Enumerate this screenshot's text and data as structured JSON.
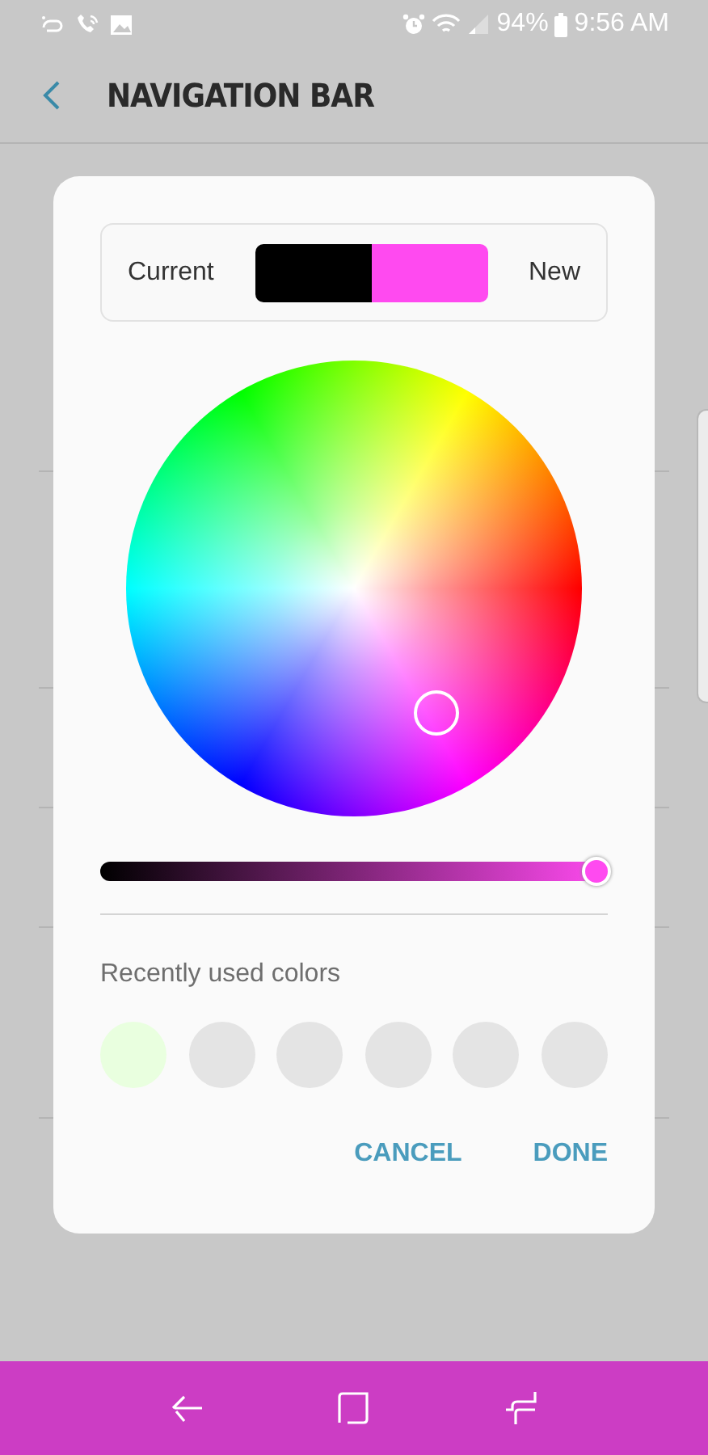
{
  "status_bar": {
    "battery": "94%",
    "time": "9:56 AM"
  },
  "app_bar": {
    "title": "NAVIGATION BAR"
  },
  "dialog": {
    "current_label": "Current",
    "new_label": "New",
    "swatches": [
      {
        "kind": "current",
        "color": "#000000"
      },
      {
        "kind": "new",
        "color": "#ff4af0"
      }
    ],
    "brightness": {
      "level": 0.98
    },
    "recent_title": "Recently used colors",
    "recent_colors": [
      {
        "color": "#e9ffdf"
      },
      {
        "color": "#e4e4e4"
      },
      {
        "color": "#e4e4e4"
      },
      {
        "color": "#e4e4e4"
      },
      {
        "color": "#e4e4e4"
      },
      {
        "color": "#e4e4e4"
      }
    ],
    "buttons": [
      "CANCEL",
      "DONE"
    ]
  }
}
